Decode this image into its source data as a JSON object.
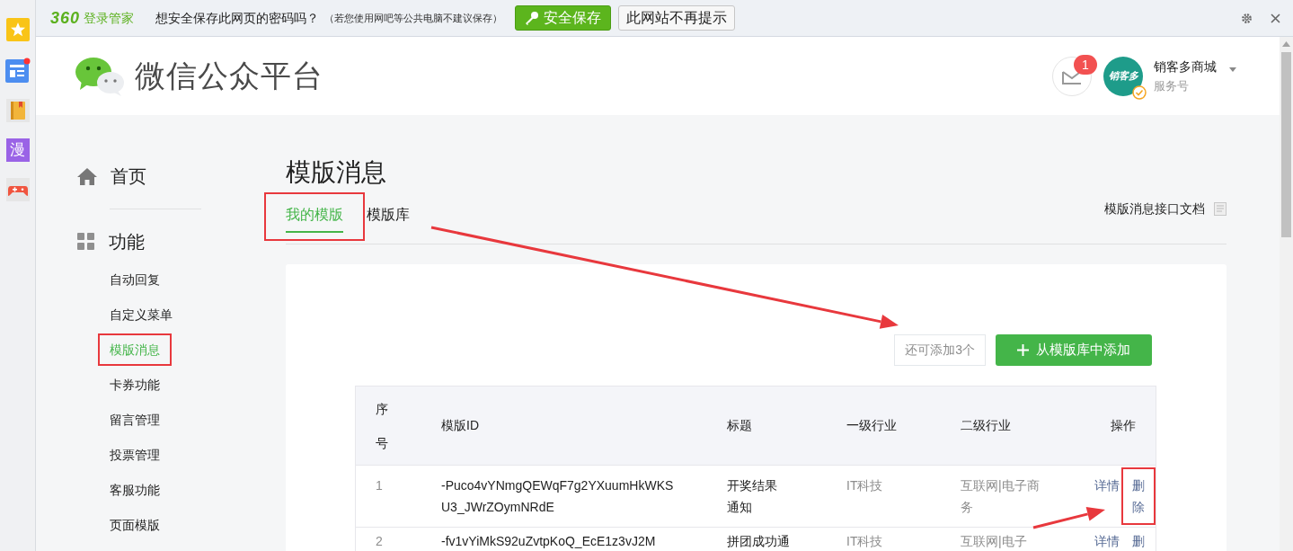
{
  "browser_sidebar": {
    "items": [
      {
        "kind": "star"
      },
      {
        "kind": "news"
      },
      {
        "kind": "book"
      },
      {
        "kind": "glyph",
        "label": "漫"
      },
      {
        "kind": "game"
      }
    ]
  },
  "password_bar": {
    "logo": "360",
    "product": "登录管家",
    "question": "想安全保存此网页的密码吗？",
    "note": "（若您使用网吧等公共电脑不建议保存）",
    "save_button": "安全保存",
    "dismiss_button": "此网站不再提示"
  },
  "header": {
    "title": "微信公众平台",
    "message_count": "1",
    "account": {
      "avatar_text": "销客多",
      "name": "销客多商城",
      "type": "服务号",
      "verified": true
    }
  },
  "sidebar": {
    "sections": [
      {
        "label": "首页"
      },
      {
        "label": "功能",
        "items": [
          {
            "label": "自动回复",
            "selected": false,
            "highlighted": false
          },
          {
            "label": "自定义菜单",
            "selected": false,
            "highlighted": false
          },
          {
            "label": "模版消息",
            "selected": true,
            "highlighted": true
          },
          {
            "label": "卡券功能",
            "selected": false,
            "highlighted": false
          },
          {
            "label": "留言管理",
            "selected": false,
            "highlighted": false
          },
          {
            "label": "投票管理",
            "selected": false,
            "highlighted": false
          },
          {
            "label": "客服功能",
            "selected": false,
            "highlighted": false
          },
          {
            "label": "页面模版",
            "selected": false,
            "highlighted": false
          }
        ]
      }
    ]
  },
  "page": {
    "title": "模版消息",
    "tabs": [
      {
        "label": "我的模版",
        "selected": true,
        "highlighted": true
      },
      {
        "label": "模版库",
        "selected": false,
        "highlighted": false
      }
    ],
    "doc_link": "模版消息接口文档",
    "remaining": "还可添加3个",
    "add_button": "从模版库中添加",
    "table": {
      "columns": [
        "序号",
        "模版ID",
        "标题",
        "一级行业",
        "二级行业",
        "操作"
      ],
      "rows": [
        {
          "index": "1",
          "template_id": "-Puco4vYNmgQEWqF7g2YXuumHkWKSU3_JWrZOymNRdE",
          "title": "开奖结果通知",
          "industry_1": "IT科技",
          "industry_2": "互联网|电子商务",
          "actions": [
            {
              "label": "详情",
              "highlighted": false
            },
            {
              "label": "删除",
              "highlighted": true
            }
          ]
        },
        {
          "index": "2",
          "template_id": "-fv1vYiMkS92uZvtpKoQ_EcE1z3vJ2M",
          "title": "拼团成功通",
          "industry_1": "IT科技",
          "industry_2": "互联网|电子",
          "actions": [
            {
              "label": "详情",
              "highlighted": false
            },
            {
              "label": "删",
              "highlighted": false
            }
          ]
        }
      ]
    }
  },
  "annotations": [
    {
      "kind": "arrow"
    },
    {
      "kind": "arrow"
    }
  ]
}
